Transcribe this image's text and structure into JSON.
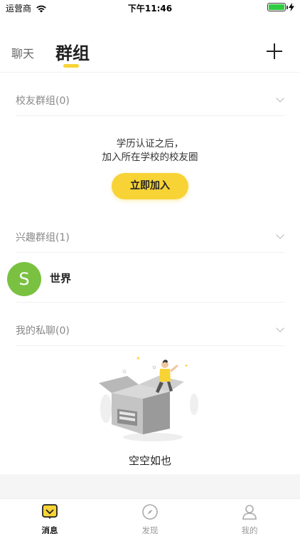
{
  "status": {
    "carrier": "运营商",
    "time": "下午11:46"
  },
  "header": {
    "tab_chat": "聊天",
    "tab_group": "群组"
  },
  "sections": {
    "alumni": {
      "title": "校友群组(0)"
    },
    "interest": {
      "title": "兴趣群组(1)"
    },
    "private": {
      "title": "我的私聊(0)"
    }
  },
  "alumni_empty": {
    "line1": "学历认证之后，",
    "line2": "加入所在学校的校友圈",
    "join_button": "立即加入"
  },
  "groups": [
    {
      "avatar_letter": "S",
      "name": "世界"
    }
  ],
  "empty_state": {
    "text": "空空如也"
  },
  "tabbar": {
    "messages": "消息",
    "discover": "发现",
    "mine": "我的"
  },
  "colors": {
    "accent": "#f7d336",
    "avatar": "#7ac142",
    "battery": "#2ecc40"
  },
  "icons": {
    "wifi": "wifi-icon",
    "battery": "battery-icon",
    "plus": "plus-icon",
    "chevron": "chevron-down-icon",
    "messages": "message-icon",
    "discover": "compass-icon",
    "mine": "user-icon"
  }
}
